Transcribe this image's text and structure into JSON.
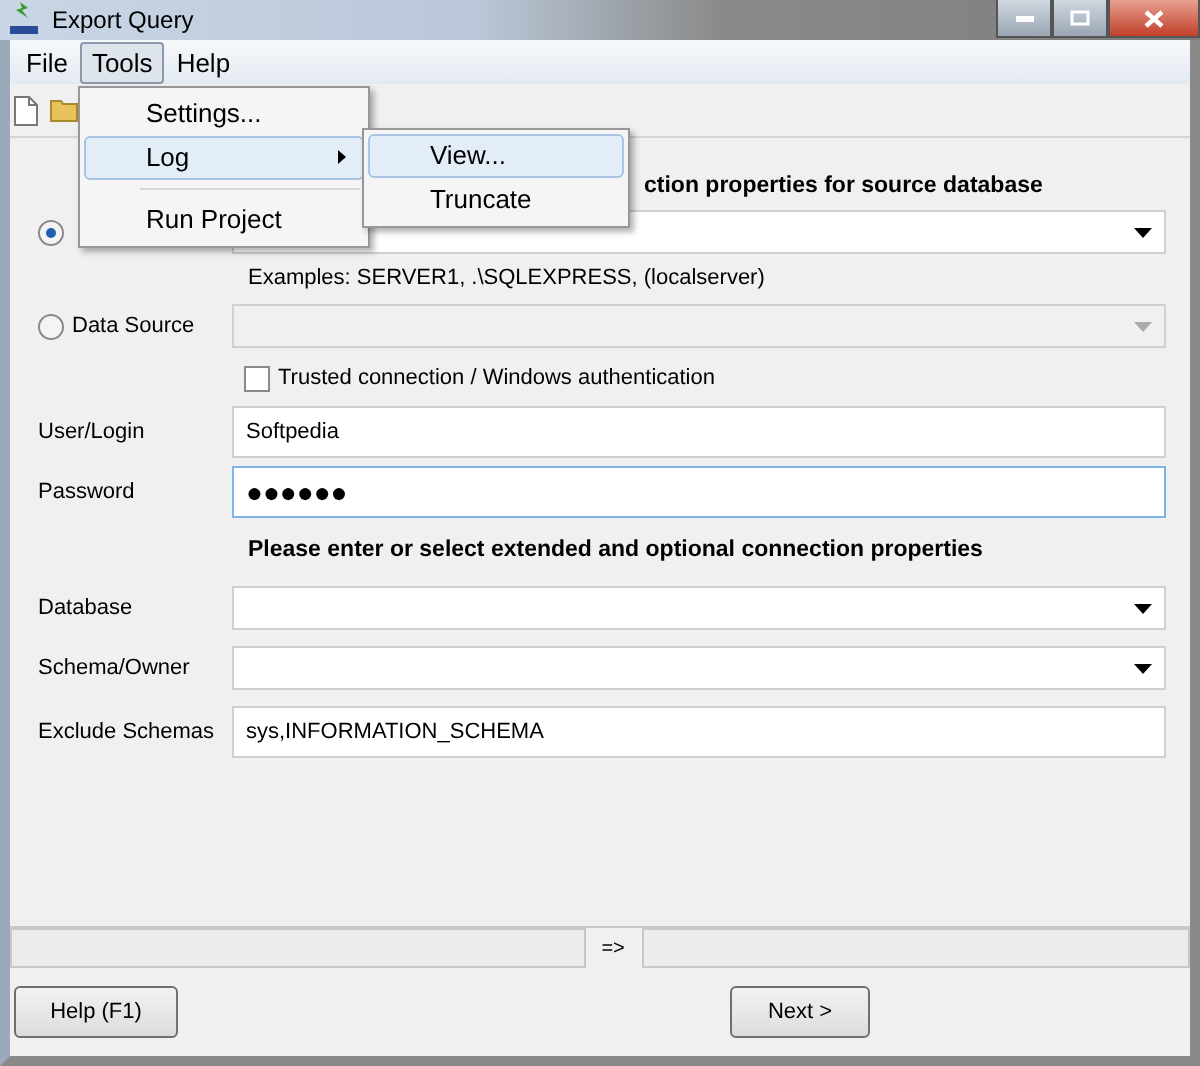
{
  "window": {
    "title": "Export Query"
  },
  "menu_bar": [
    {
      "label": "File",
      "selected": false
    },
    {
      "label": "Tools",
      "selected": true
    },
    {
      "label": "Help",
      "selected": false
    }
  ],
  "tools_menu": [
    {
      "kind": "item",
      "label": "Settings...",
      "highlighted": false
    },
    {
      "kind": "submenu",
      "label": "Log",
      "highlighted": true
    },
    {
      "kind": "separator"
    },
    {
      "kind": "item",
      "label": "Run Project",
      "highlighted": false
    }
  ],
  "log_submenu": [
    {
      "label": "View...",
      "highlighted": true
    },
    {
      "label": "Truncate",
      "highlighted": false
    }
  ],
  "heading": "ction properties for source database",
  "server_option": {
    "selected": true
  },
  "examples": "Examples: SERVER1, .\\SQLEXPRESS, (localserver)",
  "data_source": {
    "label": "Data Source",
    "selected": false,
    "disabled": true
  },
  "trusted": {
    "label": "Trusted connection / Windows authentication",
    "checked": false
  },
  "fields": [
    {
      "kind": "text",
      "label": "User/Login",
      "value": "Softpedia",
      "focused": false
    },
    {
      "kind": "password",
      "label": "Password",
      "value": "●●●●●●",
      "focused": true
    }
  ],
  "heading_2": "Please enter or select extended and optional connection properties",
  "extended_fields": [
    {
      "kind": "combo",
      "label": "Database"
    },
    {
      "kind": "combo",
      "label": "Schema/Owner"
    },
    {
      "kind": "text",
      "label": "Exclude Schemas",
      "value": "sys,INFORMATION_SCHEMA"
    }
  ],
  "status_bar": {
    "separator": "=>"
  },
  "buttons": [
    {
      "label": "Help (F1)"
    },
    {
      "label": "Next >"
    }
  ]
}
